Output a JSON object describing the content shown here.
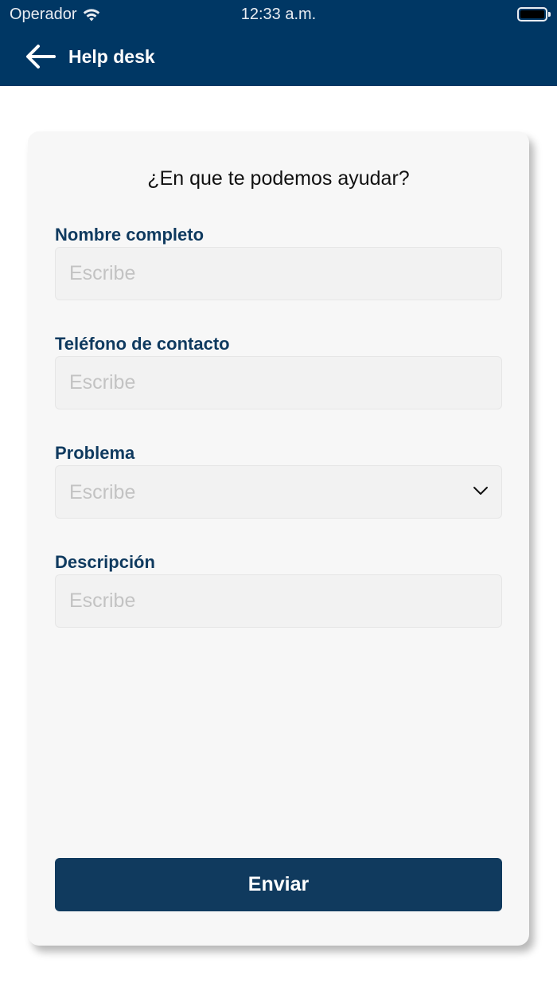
{
  "status_bar": {
    "carrier": "Operador",
    "time": "12:33 a.m."
  },
  "header": {
    "title": "Help desk",
    "background": "#003764"
  },
  "form": {
    "heading": "¿En que te podemos ayudar?",
    "fields": [
      {
        "label": "Nombre completo",
        "placeholder": "Escribe",
        "value": ""
      },
      {
        "label": "Teléfono de contacto",
        "placeholder": "Escribe",
        "value": ""
      },
      {
        "label": "Problema",
        "placeholder": "Escribe",
        "selected": ""
      },
      {
        "label": "Descripción",
        "placeholder": "Escribe",
        "value": ""
      }
    ],
    "submit_label": "Enviar",
    "accent_color": "#103a5e"
  }
}
